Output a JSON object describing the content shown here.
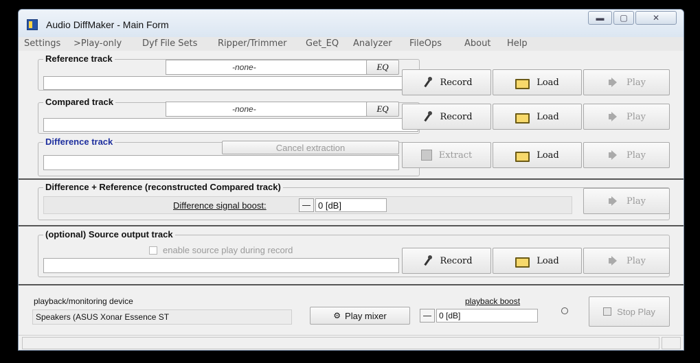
{
  "window": {
    "title": "Audio DiffMaker - Main Form",
    "min_label": "—",
    "max_label": "▫",
    "close_label": "X"
  },
  "menu": [
    "Settings",
    ">Play-only",
    "Dyf File Sets",
    "Ripper/Trimmer",
    "Get_EQ",
    "Analyzer",
    "FileOps",
    "About",
    "Help"
  ],
  "reference": {
    "label": "Reference track",
    "source": "-none-",
    "eq": "EQ",
    "path": ""
  },
  "compared": {
    "label": "Compared track",
    "source": "-none-",
    "eq": "EQ",
    "path": ""
  },
  "difference": {
    "label": "Difference track",
    "cancel": "Cancel extraction",
    "extract": "Extract",
    "path": ""
  },
  "diffref": {
    "label": "Difference + Reference   (reconstructed Compared track)",
    "boost_label": "Difference signal boost:",
    "boost_value": "0 [dB]"
  },
  "source_out": {
    "label": "(optional) Source output track",
    "checkbox": "enable source play during record",
    "path": ""
  },
  "buttons": {
    "record": "Record",
    "load": "Load",
    "play": "Play"
  },
  "device": {
    "label": "playback/monitoring device",
    "value": "Speakers (ASUS Xonar Essence ST",
    "mixer": "Play mixer",
    "boost_label": "playback boost",
    "boost_value": "0 [dB]",
    "stop": "Stop Play"
  },
  "icons": [
    "microphone-icon",
    "folder-icon",
    "speaker-icon",
    "stop-icon",
    "mixer-icon",
    "app-icon"
  ]
}
